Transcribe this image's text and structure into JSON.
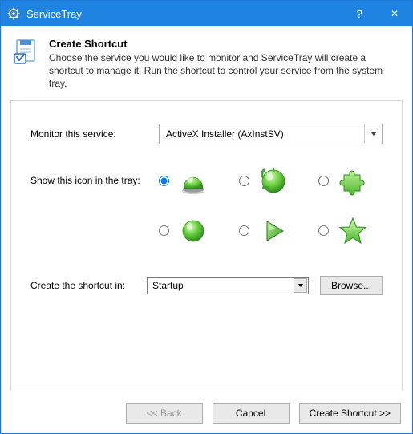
{
  "titlebar": {
    "app_name": "ServiceTray",
    "help_glyph": "?",
    "close_glyph": "✕"
  },
  "header": {
    "title": "Create Shortcut",
    "description": "Choose the service you would like to monitor and ServiceTray will create a shortcut to manage it. Run the shortcut to control your service from the system tray."
  },
  "form": {
    "monitor_label": "Monitor this service:",
    "monitor_value": "ActiveX Installer (AxInstSV)",
    "icon_label": "Show this icon in the tray:",
    "location_label": "Create the shortcut in:",
    "location_value": "Startup",
    "browse_label": "Browse..."
  },
  "tray_icons": [
    {
      "name": "dome-icon",
      "selected": true
    },
    {
      "name": "bell-icon",
      "selected": false
    },
    {
      "name": "puzzle-icon",
      "selected": false
    },
    {
      "name": "circle-icon",
      "selected": false
    },
    {
      "name": "play-icon",
      "selected": false
    },
    {
      "name": "star-icon",
      "selected": false
    }
  ],
  "footer": {
    "back_label": "<< Back",
    "cancel_label": "Cancel",
    "next_label": "Create Shortcut >>"
  },
  "colors": {
    "titlebar": "#1e83e1",
    "icon_green": "#52c234",
    "icon_green_dark": "#2e8b1f"
  }
}
